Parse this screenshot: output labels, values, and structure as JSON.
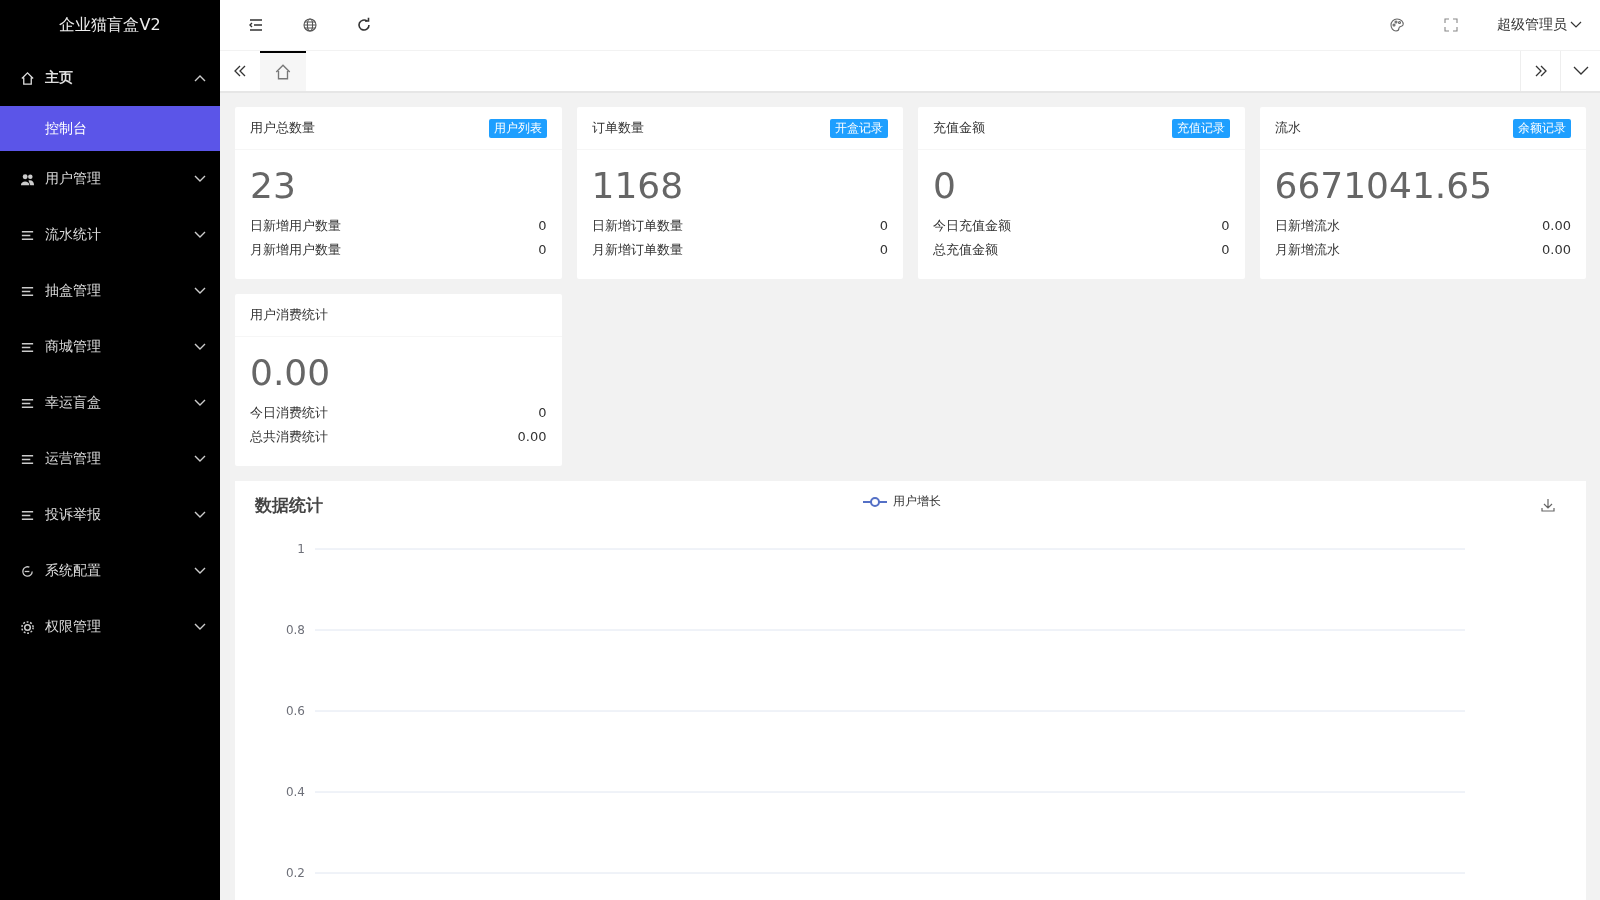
{
  "sidebar": {
    "title": "企业猫盲盒V2",
    "items": [
      {
        "label": "主页",
        "expanded": true,
        "children": [
          {
            "label": "控制台",
            "selected": true
          }
        ]
      },
      {
        "label": "用户管理",
        "expanded": false
      },
      {
        "label": "流水统计",
        "expanded": false
      },
      {
        "label": "抽盒管理",
        "expanded": false
      },
      {
        "label": "商城管理",
        "expanded": false
      },
      {
        "label": "幸运盲盒",
        "expanded": false
      },
      {
        "label": "运营管理",
        "expanded": false
      },
      {
        "label": "投诉举报",
        "expanded": false
      },
      {
        "label": "系统配置",
        "expanded": false
      },
      {
        "label": "权限管理",
        "expanded": false
      }
    ]
  },
  "header": {
    "user": "超级管理员"
  },
  "stat_cards": [
    {
      "title": "用户总数量",
      "badge": "用户列表",
      "value": "23",
      "rows": [
        {
          "label": "日新增用户数量",
          "value": "0"
        },
        {
          "label": "月新增用户数量",
          "value": "0"
        }
      ]
    },
    {
      "title": "订单数量",
      "badge": "开盒记录",
      "value": "1168",
      "rows": [
        {
          "label": "日新增订单数量",
          "value": "0"
        },
        {
          "label": "月新增订单数量",
          "value": "0"
        }
      ]
    },
    {
      "title": "充值金额",
      "badge": "充值记录",
      "value": "0",
      "rows": [
        {
          "label": "今日充值金额",
          "value": "0"
        },
        {
          "label": "总充值金额",
          "value": "0"
        }
      ]
    },
    {
      "title": "流水",
      "badge": "余额记录",
      "value": "6671041.65",
      "rows": [
        {
          "label": "日新增流水",
          "value": "0.00"
        },
        {
          "label": "月新增流水",
          "value": "0.00"
        }
      ]
    },
    {
      "title": "用户消费统计",
      "value": "0.00",
      "rows": [
        {
          "label": "今日消费统计",
          "value": "0"
        },
        {
          "label": "总共消费统计",
          "value": "0.00"
        }
      ]
    }
  ],
  "chart_panel": {
    "title": "数据统计",
    "chart_data": {
      "type": "line",
      "series": [
        {
          "name": "用户增长",
          "color": "#5470c6"
        }
      ],
      "ylim": [
        0.2,
        1
      ],
      "yticks": [
        0.2,
        0.4,
        0.6,
        0.8,
        1
      ],
      "grid": true
    }
  }
}
